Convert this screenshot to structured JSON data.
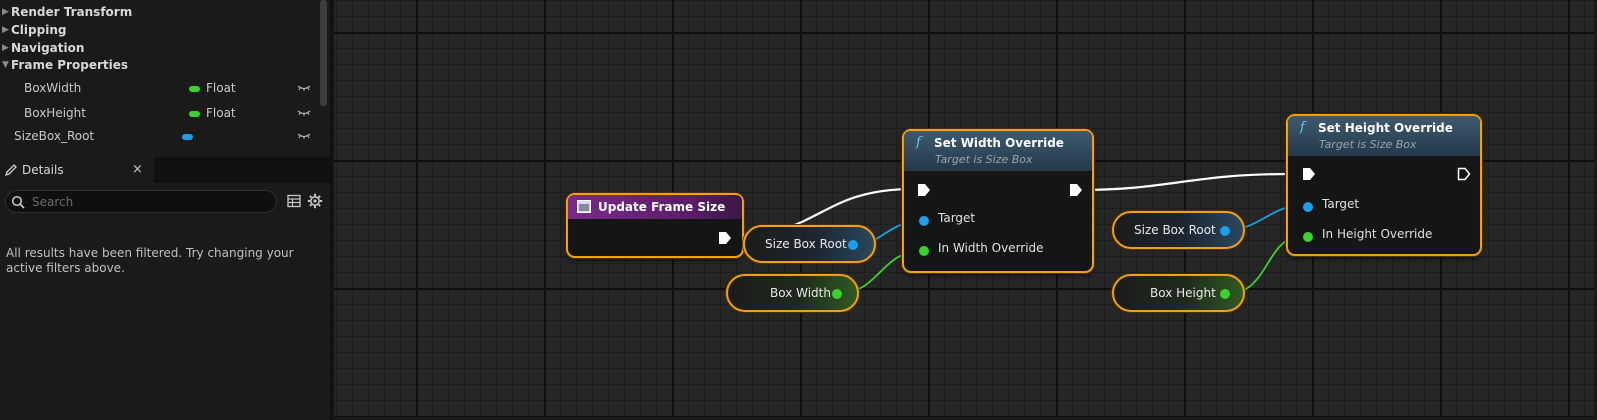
{
  "details_panel": {
    "categories": [
      {
        "label": "Render Transform",
        "expanded": false
      },
      {
        "label": "Clipping",
        "expanded": false
      },
      {
        "label": "Navigation",
        "expanded": false
      },
      {
        "label": "Frame Properties",
        "expanded": true
      }
    ],
    "properties": [
      {
        "name": "BoxWidth",
        "type": "Float",
        "pin_color": "#3bd12e"
      },
      {
        "name": "BoxHeight",
        "type": "Float",
        "pin_color": "#3bd12e"
      },
      {
        "name": "SizeBox_Root",
        "type": "",
        "pin_color": "#1a9fe8"
      }
    ],
    "tab_label": "Details",
    "tab_close": "×",
    "search_placeholder": "Search",
    "filter_message": "All results have been filtered. Try changing your active filters above."
  },
  "graph": {
    "event_node": {
      "title": "Update Frame Size",
      "header_color": "#6a1f7a"
    },
    "set_width_node": {
      "func_glyph": "f",
      "title": "Set Width Override",
      "subtitle": "Target is Size Box",
      "pins": [
        "Target",
        "In Width Override"
      ]
    },
    "set_height_node": {
      "func_glyph": "f",
      "title": "Set Height Override",
      "subtitle": "Target is Size Box",
      "pins": [
        "Target",
        "In Height Override"
      ]
    },
    "variables": {
      "size_box_root_1": "Size Box Root",
      "box_width": "Box Width",
      "size_box_root_2": "Size Box Root",
      "box_height": "Box Height"
    },
    "colors": {
      "selection": "#f0a010",
      "float_pin": "#3bd12e",
      "object_pin": "#1a9fe8",
      "exec_wire": "#ffffff"
    }
  }
}
